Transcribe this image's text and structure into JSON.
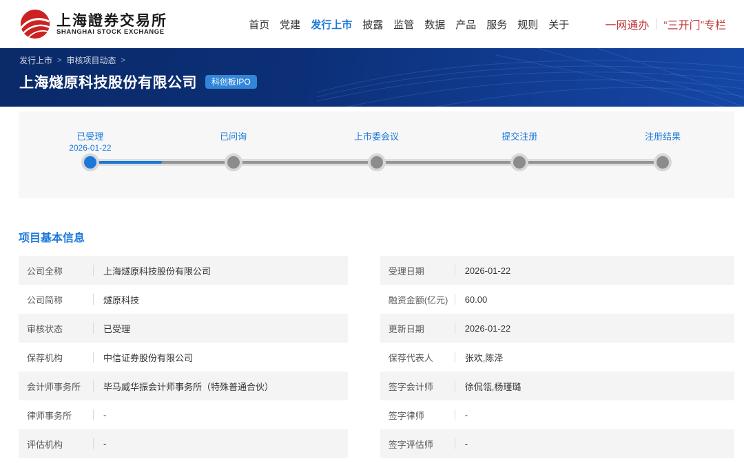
{
  "colors": {
    "accent_blue": "#1b78d9",
    "badge_blue": "#3286d9",
    "link_red": "#c03a3a",
    "logo_red": "#cc2222",
    "banner_dark": "#0a2a68",
    "banner_light": "#1547a6"
  },
  "header": {
    "logo": {
      "cn": "上海證券交易所",
      "en": "SHANGHAI STOCK EXCHANGE"
    },
    "nav": [
      {
        "label": "首页",
        "active": false
      },
      {
        "label": "党建",
        "active": false
      },
      {
        "label": "发行上市",
        "active": true
      },
      {
        "label": "披露",
        "active": false
      },
      {
        "label": "监管",
        "active": false
      },
      {
        "label": "数据",
        "active": false
      },
      {
        "label": "产品",
        "active": false
      },
      {
        "label": "服务",
        "active": false
      },
      {
        "label": "规则",
        "active": false
      },
      {
        "label": "关于",
        "active": false
      }
    ],
    "quick_links": [
      "一网通办",
      "“三开门”专栏"
    ]
  },
  "banner": {
    "breadcrumb": [
      "发行上市",
      "审核项目动态"
    ],
    "title": "上海燧原科技股份有限公司",
    "badge": "科创板IPO"
  },
  "timeline": {
    "steps": [
      {
        "label": "已受理",
        "date": "2026-01-22",
        "active": true
      },
      {
        "label": "已问询",
        "date": "",
        "active": false
      },
      {
        "label": "上市委会议",
        "date": "",
        "active": false
      },
      {
        "label": "提交注册",
        "date": "",
        "active": false
      },
      {
        "label": "注册结果",
        "date": "",
        "active": false
      }
    ],
    "progress_percent_of_track": 12.5
  },
  "section": {
    "title": "项目基本信息"
  },
  "info": {
    "left": [
      {
        "label": "公司全称",
        "value": "上海燧原科技股份有限公司"
      },
      {
        "label": "公司简称",
        "value": "燧原科技"
      },
      {
        "label": "审核状态",
        "value": "已受理"
      },
      {
        "label": "保荐机构",
        "value": "中信证券股份有限公司"
      },
      {
        "label": "会计师事务所",
        "value": "毕马威华振会计师事务所（特殊普通合伙）"
      },
      {
        "label": "律师事务所",
        "value": "-"
      },
      {
        "label": "评估机构",
        "value": "-"
      }
    ],
    "right": [
      {
        "label": "受理日期",
        "value": "2026-01-22"
      },
      {
        "label": "融资金额(亿元)",
        "value": "60.00"
      },
      {
        "label": "更新日期",
        "value": "2026-01-22"
      },
      {
        "label": "保荐代表人",
        "value": "张欢,陈泽"
      },
      {
        "label": "签字会计师",
        "value": "徐侃瓴,杨瑾璐"
      },
      {
        "label": "签字律师",
        "value": "-"
      },
      {
        "label": "签字评估师",
        "value": "-"
      }
    ]
  }
}
